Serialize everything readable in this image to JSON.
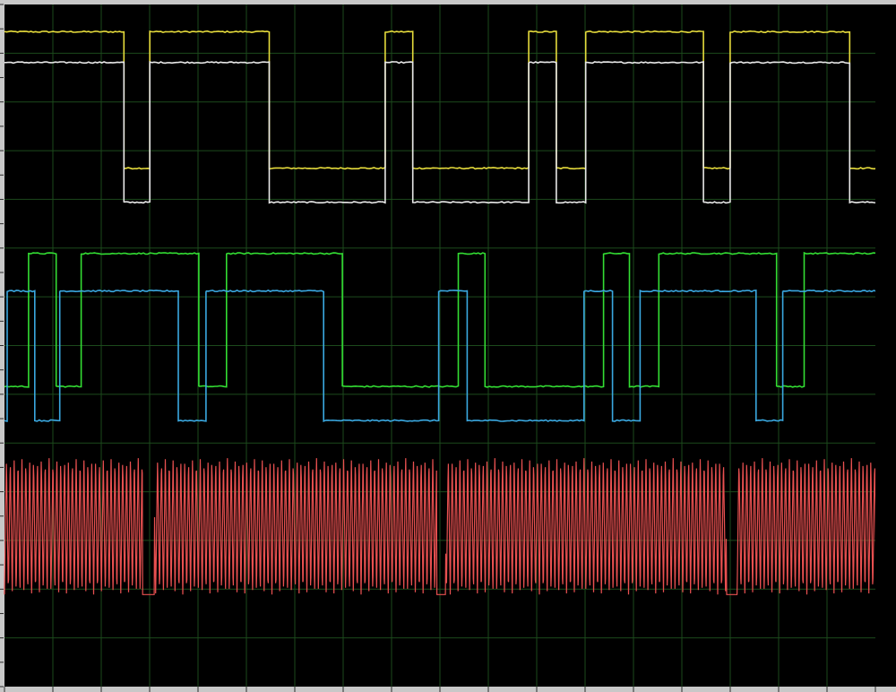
{
  "colors": {
    "background": "#000000",
    "grid": "#1c4a1c",
    "frame": "#c8c8c8",
    "tick": "#2b2b2b"
  },
  "chart_data": {
    "type": "line",
    "title": "",
    "xlabel": "",
    "ylabel": "",
    "grid": true,
    "legend": "none",
    "x_divisions": 18,
    "y_divisions": 14,
    "xlim": [
      0,
      1
    ],
    "ylim": [
      -1,
      1
    ],
    "series": [
      {
        "key": "ch1",
        "color": "#e6dc3c",
        "type": "digital",
        "high": 0.92,
        "low": 0.52,
        "noise": 0.002,
        "transitions": [
          [
            0.0,
            1
          ],
          [
            0.134,
            0
          ],
          [
            0.163,
            1
          ],
          [
            0.297,
            0
          ],
          [
            0.427,
            1
          ],
          [
            0.458,
            0
          ],
          [
            0.588,
            1
          ],
          [
            0.619,
            0
          ],
          [
            0.652,
            1
          ],
          [
            0.784,
            0
          ],
          [
            0.814,
            1
          ],
          [
            0.948,
            0
          ],
          [
            1.0,
            0
          ]
        ]
      },
      {
        "key": "ch2",
        "color": "#e8e8e8",
        "type": "digital",
        "high": 0.83,
        "low": 0.42,
        "noise": 0.002,
        "transitions": [
          [
            0.0,
            1
          ],
          [
            0.134,
            0
          ],
          [
            0.163,
            1
          ],
          [
            0.297,
            0
          ],
          [
            0.427,
            1
          ],
          [
            0.458,
            0
          ],
          [
            0.588,
            1
          ],
          [
            0.619,
            0
          ],
          [
            0.652,
            1
          ],
          [
            0.784,
            0
          ],
          [
            0.814,
            1
          ],
          [
            0.948,
            0
          ],
          [
            1.0,
            0
          ]
        ]
      },
      {
        "key": "ch3",
        "color": "#33dd33",
        "type": "digital",
        "high": 0.27,
        "low": -0.12,
        "noise": 0.002,
        "transitions": [
          [
            0.0,
            0
          ],
          [
            0.027,
            1
          ],
          [
            0.058,
            0
          ],
          [
            0.086,
            1
          ],
          [
            0.218,
            0
          ],
          [
            0.249,
            1
          ],
          [
            0.379,
            0
          ],
          [
            0.509,
            1
          ],
          [
            0.539,
            0
          ],
          [
            0.672,
            1
          ],
          [
            0.701,
            0
          ],
          [
            0.734,
            1
          ],
          [
            0.866,
            0
          ],
          [
            0.897,
            1
          ],
          [
            1.0,
            1
          ]
        ]
      },
      {
        "key": "ch4",
        "color": "#3aa8e0",
        "type": "digital",
        "high": 0.16,
        "low": -0.22,
        "noise": 0.002,
        "transitions": [
          [
            0.0,
            0
          ],
          [
            0.003,
            1
          ],
          [
            0.034,
            0
          ],
          [
            0.062,
            1
          ],
          [
            0.195,
            0
          ],
          [
            0.226,
            1
          ],
          [
            0.358,
            0
          ],
          [
            0.487,
            1
          ],
          [
            0.519,
            0
          ],
          [
            0.65,
            1
          ],
          [
            0.682,
            0
          ],
          [
            0.713,
            1
          ],
          [
            0.843,
            0
          ],
          [
            0.873,
            1
          ],
          [
            1.0,
            1
          ]
        ]
      },
      {
        "key": "ch5",
        "color": "#e85050",
        "type": "burst",
        "high": -0.33,
        "low": -0.73,
        "idle": -0.73,
        "cycles_per_unit": 230,
        "bursts": [
          [
            0.0,
            0.155
          ],
          [
            0.168,
            0.485
          ],
          [
            0.495,
            0.81
          ],
          [
            0.822,
            1.0
          ]
        ]
      }
    ]
  }
}
